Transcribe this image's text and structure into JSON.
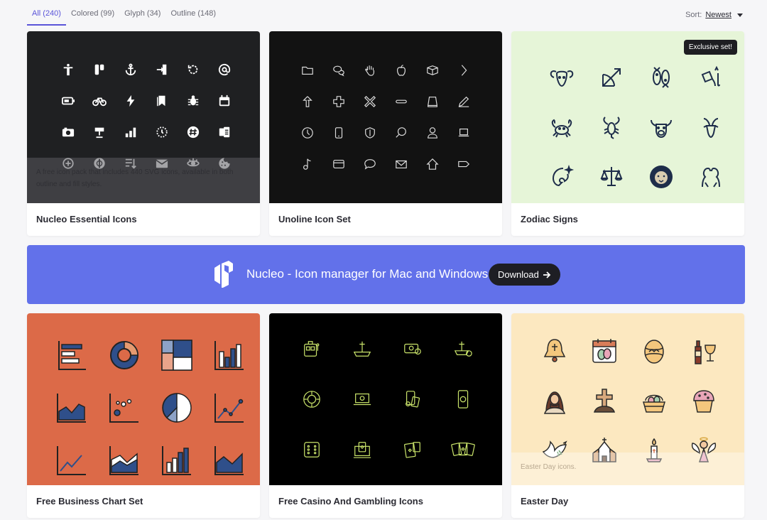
{
  "filters": {
    "tabs": [
      {
        "label": "All (240)"
      },
      {
        "label": "Colored (99)"
      },
      {
        "label": "Glyph (34)"
      },
      {
        "label": "Outline (148)"
      }
    ],
    "sort_label": "Sort:",
    "sort_value": "Newest"
  },
  "cards": [
    {
      "title": "Nucleo Essential Icons",
      "bg": "#1f2022",
      "overlay": "A free icon pack that includes 440 SVG icons, available in both outline and fill styles."
    },
    {
      "title": "Unoline Icon Set",
      "bg": "#121212"
    },
    {
      "title": "Zodiac Signs",
      "bg": "#e6f5d8",
      "badge": "Exclusive set!"
    },
    {
      "title": "Free Business Chart Set",
      "bg": "#dc6a48"
    },
    {
      "title": "Free Casino And Gambling Icons",
      "bg": "#000000"
    },
    {
      "title": "Easter Day",
      "bg": "#fce8c0",
      "overlay": "Easter Day icons."
    }
  ],
  "banner": {
    "text": "Nucleo - Icon manager for Mac and Windows",
    "button": "Download",
    "bg": "#6271ea"
  }
}
